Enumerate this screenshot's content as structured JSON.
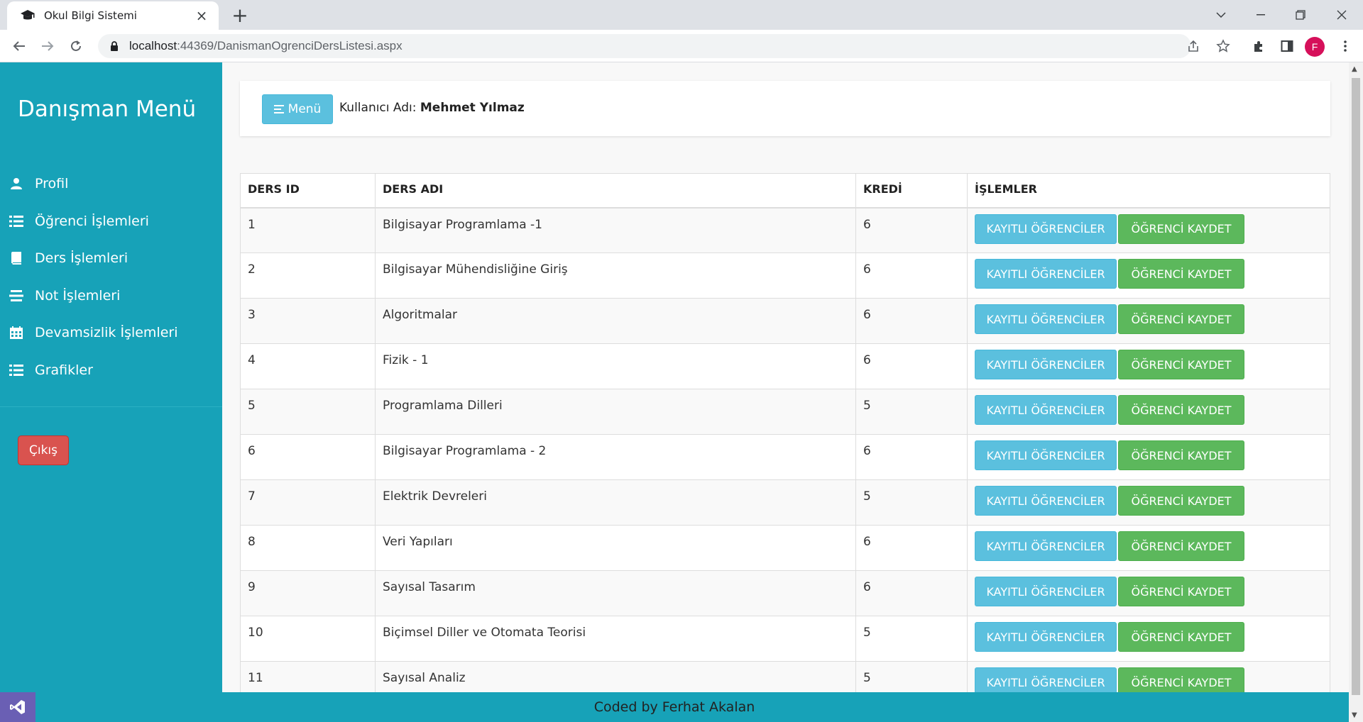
{
  "browser": {
    "tab_title": "Okul Bilgi Sistemi",
    "url_host": "localhost",
    "url_rest": ":44369/DanismanOgrenciDersListesi.aspx",
    "profile_initial": "F"
  },
  "sidebar": {
    "brand": "Danışman Menü",
    "items": [
      {
        "label": "Profil",
        "icon": "user-icon"
      },
      {
        "label": "Öğrenci İşlemleri",
        "icon": "list-icon"
      },
      {
        "label": "Ders İşlemleri",
        "icon": "book-icon"
      },
      {
        "label": "Not İşlemleri",
        "icon": "tasks-icon"
      },
      {
        "label": "Devamsizlik İşlemleri",
        "icon": "calendar-icon"
      },
      {
        "label": "Grafikler",
        "icon": "list-icon"
      }
    ],
    "logout_label": "Çıkış"
  },
  "header": {
    "menu_button": "Menü",
    "user_label": "Kullanıcı Adı:",
    "user_name": "Mehmet Yılmaz"
  },
  "table": {
    "columns": [
      "DERS ID",
      "DERS ADI",
      "KREDİ",
      "İŞLEMLER"
    ],
    "rows": [
      {
        "id": "1",
        "name": "Bilgisayar Programlama -1",
        "credit": "6"
      },
      {
        "id": "2",
        "name": "Bilgisayar Mühendisliğine Giriş",
        "credit": "6"
      },
      {
        "id": "3",
        "name": "Algoritmalar",
        "credit": "6"
      },
      {
        "id": "4",
        "name": "Fizik - 1",
        "credit": "6"
      },
      {
        "id": "5",
        "name": "Programlama Dilleri",
        "credit": "5"
      },
      {
        "id": "6",
        "name": "Bilgisayar Programlama - 2",
        "credit": "6"
      },
      {
        "id": "7",
        "name": "Elektrik Devreleri",
        "credit": "5"
      },
      {
        "id": "8",
        "name": "Veri Yapıları",
        "credit": "6"
      },
      {
        "id": "9",
        "name": "Sayısal Tasarım",
        "credit": "6"
      },
      {
        "id": "10",
        "name": "Biçimsel Diller ve Otomata Teorisi",
        "credit": "5"
      },
      {
        "id": "11",
        "name": "Sayısal Analiz",
        "credit": "5"
      }
    ],
    "btn_students": "KAYITLI ÖĞRENCİLER",
    "btn_register": "ÖĞRENCİ KAYDET"
  },
  "footer": {
    "text": "Coded by Ferhat Akalan"
  },
  "colors": {
    "sidebar": "#17a2b8",
    "info": "#5bc0de",
    "success": "#5cb85c",
    "danger": "#d9534f"
  }
}
